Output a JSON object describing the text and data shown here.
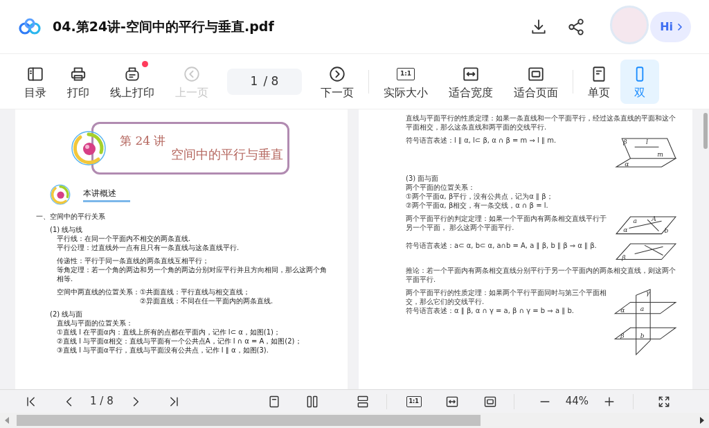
{
  "header": {
    "title": "04.第24讲-空间中的平行与垂直.pdf",
    "greeting": "Hi"
  },
  "toolbar": {
    "items": [
      {
        "kind": "button",
        "label": "目录",
        "selected": false,
        "disabled": false,
        "badge": false
      },
      {
        "kind": "button",
        "label": "打印",
        "selected": false,
        "disabled": false,
        "badge": false
      },
      {
        "kind": "button",
        "label": "线上打印",
        "selected": false,
        "disabled": false,
        "badge": true
      },
      {
        "kind": "button",
        "label": "上一页",
        "selected": false,
        "disabled": true,
        "badge": false
      },
      {
        "kind": "page",
        "value": "1",
        "total": "/ 8"
      },
      {
        "kind": "button",
        "label": "下一页",
        "selected": false,
        "disabled": false,
        "badge": false
      },
      {
        "kind": "divider"
      },
      {
        "kind": "button",
        "label": "实际大小",
        "glyph": "1:1",
        "selected": false,
        "disabled": false,
        "badge": false
      },
      {
        "kind": "button",
        "label": "适合宽度",
        "selected": false,
        "disabled": false,
        "badge": false
      },
      {
        "kind": "button",
        "label": "适合页面",
        "selected": false,
        "disabled": false,
        "badge": false
      },
      {
        "kind": "divider"
      },
      {
        "kind": "button",
        "label": "单页",
        "selected": false,
        "disabled": false,
        "badge": false
      },
      {
        "kind": "button",
        "label": "双",
        "selected": true,
        "disabled": false,
        "badge": false
      }
    ]
  },
  "left_page": {
    "lecture": "第 24 讲",
    "title": "空间中的平行与垂直",
    "overview": "本讲概述",
    "heading": "一、空间中的平行关系",
    "sections": [
      {
        "title": "(1) 线与线",
        "paragraphs": [
          {
            "kind": "lines",
            "lines": [
              "平行线：在同一个平面内不相交的两条直线.",
              "平行公理：过直线外一点有且只有一条直线与这条直线平行."
            ]
          },
          {
            "kind": "lines",
            "lines": [
              "传递性：平行于同一条直线的两条直线互相平行；",
              "等角定理：若一个角的两边和另一个角的两边分别对应平行并且方向相同，那么这两个角相等."
            ]
          },
          {
            "kind": "relation",
            "label": "空间中两直线的位置关系：",
            "items": [
              "①共面直线：平行直线与相交直线；",
              "②异面直线：不同在任一平面内的两条直线."
            ]
          }
        ]
      },
      {
        "title": "(2) 线与面",
        "paragraphs": [
          {
            "kind": "lines",
            "lines": [
              "直线与平面的位置关系：",
              "①直线 l 在平面α内：直线上所有的点都在平面内，记作 l⊂ α，如图(1)；",
              "②直线 l 与平面α相交：直线与平面有一个公共点A，记作 l ∩ α = A，如图(2)；",
              "③直线 l 与平面α平行，直线与平面没有公共点，记作 l ∥ α，如图(3)."
            ]
          }
        ]
      }
    ]
  },
  "right_page": {
    "rows": [
      {
        "lines": [
          "直线与平面平行的性质定理：如果一条直线和一个平面平行，经过这条直线的平面和这个平面相交，那么这条直线和两平面的交线平行."
        ]
      },
      {
        "lines": [
          "符号语言表述：l ∥ α, l⊂ β, α ∩ β = m ⇒ l ∥ m."
        ],
        "diagram": {
          "kind": "line-plane",
          "labels": [
            "β",
            "l",
            "m",
            "α"
          ]
        }
      },
      {
        "lines": [
          "(3) 面与面",
          "两个平面的位置关系：",
          "①两个平面α, β平行，没有公共点，记为α ∥ β；",
          "②两个平面α, β相交，有一条交线，α ∩ β = l."
        ]
      },
      {
        "lines": [
          "两个平面平行的判定定理：如果一个平面内有两条相交直线平行于另一个平面，  那么这两个平面平行."
        ],
        "diagram": {
          "kind": "crossing-lines",
          "labels": [
            "a",
            "A",
            "b",
            "α"
          ]
        }
      },
      {
        "lines": [
          "符号语言表述：a⊂ α, b⊂ α, a∩b = A, a ∥ β, b ∥ β ⇒ α ∥ β."
        ],
        "diagram": {
          "kind": "crossed-plane",
          "labels": [
            "β"
          ]
        }
      },
      {
        "lines": [
          "推论：若一个平面内有两条相交直线分别平行于另一个平面内的两条相交直线，则这两个平面平行."
        ]
      },
      {
        "lines": [
          "两个平面平行的性质定理：如果两个平行平面同时与第三个平面相交，那么它们的交线平行.",
          "符号语言表述：α ∥ β, α ∩ γ = a, β ∩ γ = b ⇒ a ∥ b."
        ],
        "diagram": {
          "kind": "three-planes",
          "labels": [
            "γ",
            "α",
            "a",
            "β",
            "b"
          ]
        }
      }
    ]
  },
  "bottom_bar": {
    "page": "1 / 8",
    "glyph": "1:1",
    "zoom": "44%"
  }
}
